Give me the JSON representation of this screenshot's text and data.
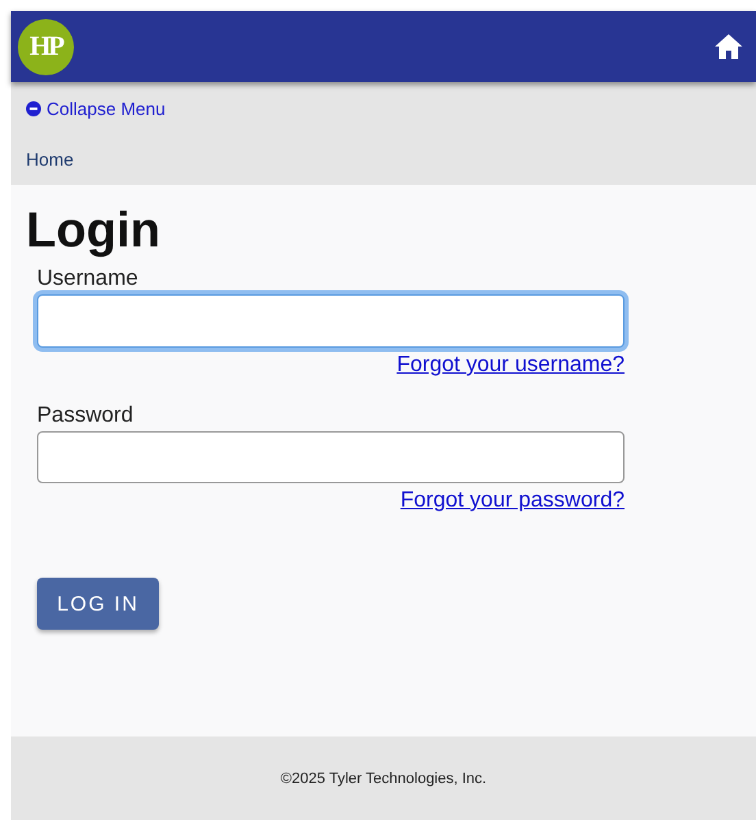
{
  "header": {
    "logo_text": "HP"
  },
  "menu": {
    "collapse": "Collapse Menu",
    "breadcrumb": "Home"
  },
  "title": "Login",
  "fields": [
    {
      "label": "Username",
      "focused": true,
      "link": "Forgot your username?"
    },
    {
      "label": "Password",
      "focused": false,
      "link": "Forgot your password?"
    }
  ],
  "button": "LOG IN",
  "footer": "©2025 Tyler Technologies, Inc."
}
